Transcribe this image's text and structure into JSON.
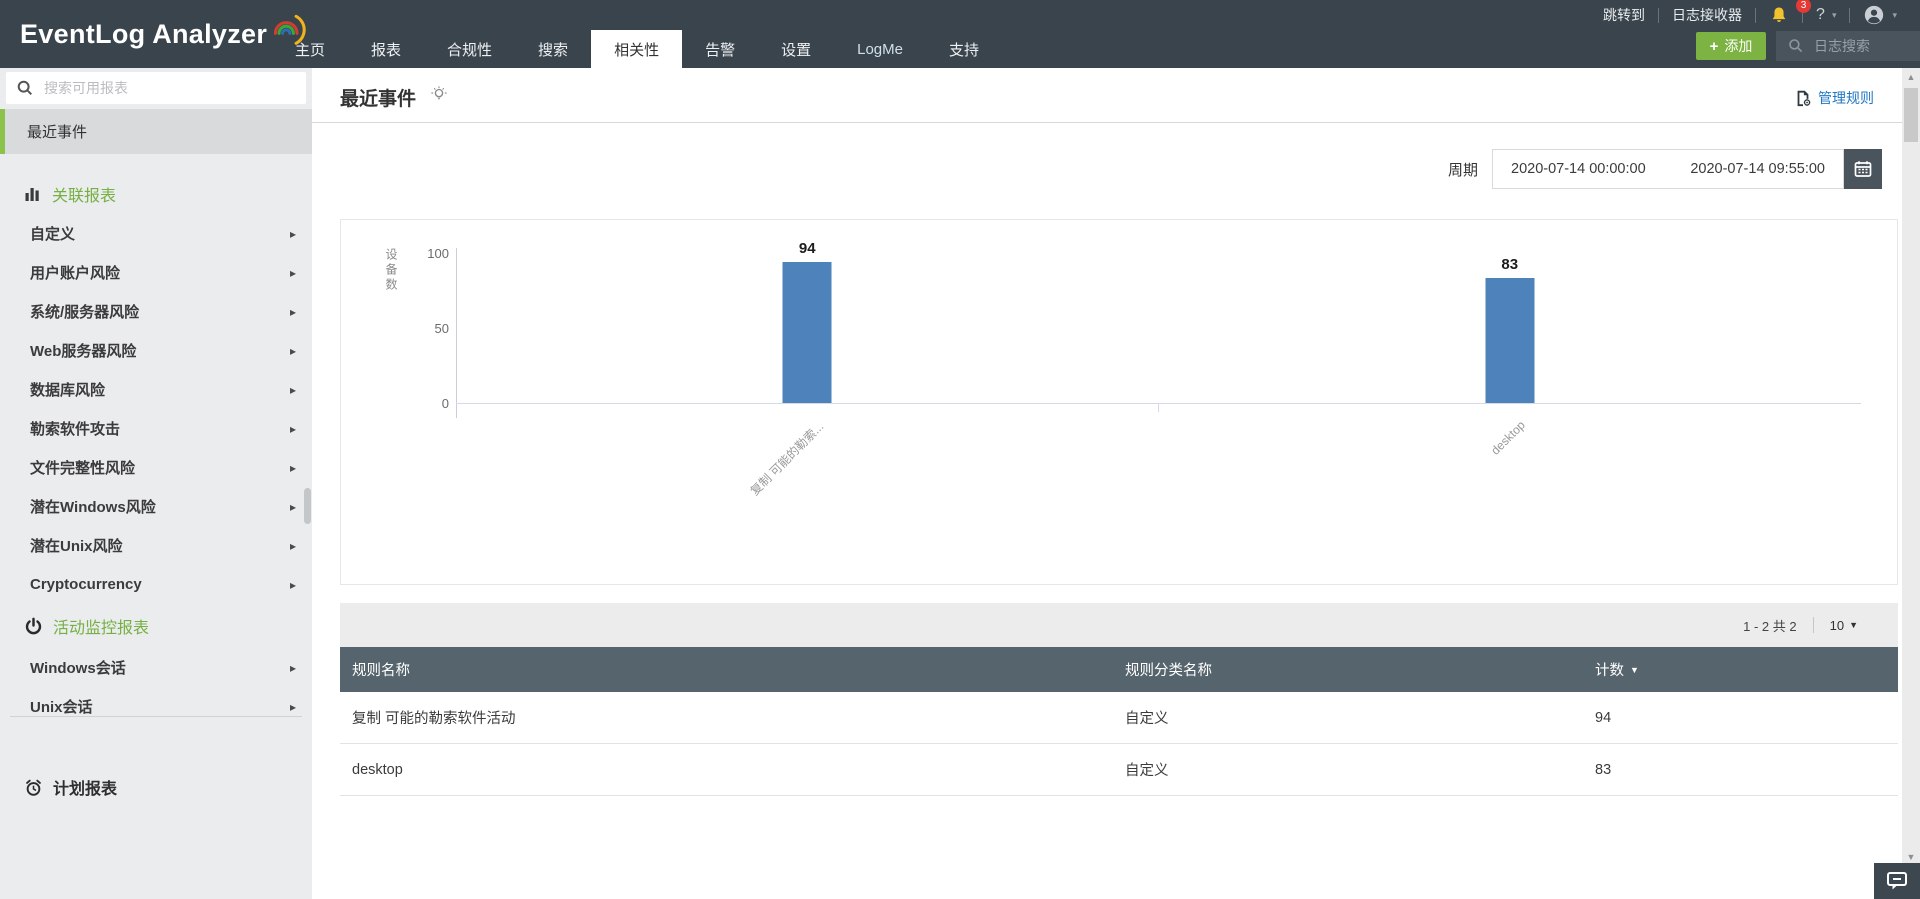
{
  "colors": {
    "topbar_bg": "#3a444c",
    "accent_green": "#76b043",
    "button_green": "#7cb342",
    "link_blue": "#2178c4",
    "bar_blue": "#4d82ba",
    "table_header_bg": "#56646d",
    "sidebar_selected_border": "#8bc34a",
    "notification_badge_red": "#e53935"
  },
  "glyphs": {
    "caret_down": "▾",
    "arrow_right": "▸",
    "sort_down": "▼",
    "scroll_up": "▲",
    "scroll_down": "▼",
    "plus": "+"
  },
  "icons": {
    "header_log_search": "search-icon",
    "sidebar_search": "search-icon",
    "notification": "bell-icon",
    "user": "avatar-icon",
    "correlation_section": "bar-chart-icon",
    "activity_section": "power-icon",
    "scheduled_reports": "alarm-clock-icon",
    "title_hint": "lightbulb-icon",
    "manage_rules": "document-gear-icon",
    "period_picker": "calendar-icon",
    "feedback": "chat-bubble-icon"
  },
  "header": {
    "logo_text": "EventLog Analyzer",
    "nav": [
      {
        "label": "主页"
      },
      {
        "label": "报表"
      },
      {
        "label": "合规性"
      },
      {
        "label": "搜索"
      },
      {
        "label": "相关性"
      },
      {
        "label": "告警"
      },
      {
        "label": "设置"
      },
      {
        "label": "LogMe"
      },
      {
        "label": "支持"
      }
    ],
    "jump_to": "跳转到",
    "log_receiver": "日志接收器",
    "notification_count": "3",
    "help_label": "?",
    "add_button_label": "添加",
    "log_search_placeholder": "日志搜索"
  },
  "sidebar": {
    "search_placeholder": "搜索可用报表",
    "selected_item": "最近事件",
    "section1": {
      "label": "关联报表",
      "items": [
        "自定义",
        "用户账户风险",
        "系统/服务器风险",
        "Web服务器风险",
        "数据库风险",
        "勒索软件攻击",
        "文件完整性风险",
        "潜在Windows风险",
        "潜在Unix风险",
        "Cryptocurrency"
      ]
    },
    "section2": {
      "label": "活动监控报表",
      "items": [
        "Windows会话",
        "Unix会话"
      ]
    },
    "footer_item": "计划报表"
  },
  "main": {
    "title": "最近事件",
    "manage_rules_label": "管理规则",
    "period": {
      "label": "周期",
      "from": "2020-07-14 00:00:00",
      "to": "2020-07-14 09:55:00"
    },
    "pagination": {
      "range": "1 - 2 共 2",
      "page_size": "10"
    },
    "table": {
      "headers": [
        "规则名称",
        "规则分类名称",
        "计数"
      ],
      "rows": [
        {
          "rule": "复制 可能的勒索软件活动",
          "category": "自定义",
          "count": "94"
        },
        {
          "rule": "desktop",
          "category": "自定义",
          "count": "83"
        }
      ]
    }
  },
  "chart_data": {
    "type": "bar",
    "categories": [
      "复制 可能的勒索...",
      "desktop"
    ],
    "full_category_names": [
      "复制 可能的勒索软件活动",
      "desktop"
    ],
    "values": [
      94,
      83
    ],
    "title": "",
    "xlabel": "",
    "ylabel": "设备数",
    "yticks": [
      100,
      50,
      0
    ],
    "ylim": [
      0,
      100
    ],
    "bar_color": "#4d82ba",
    "grid": false,
    "legend": "none",
    "category_label_rotation": -45
  }
}
